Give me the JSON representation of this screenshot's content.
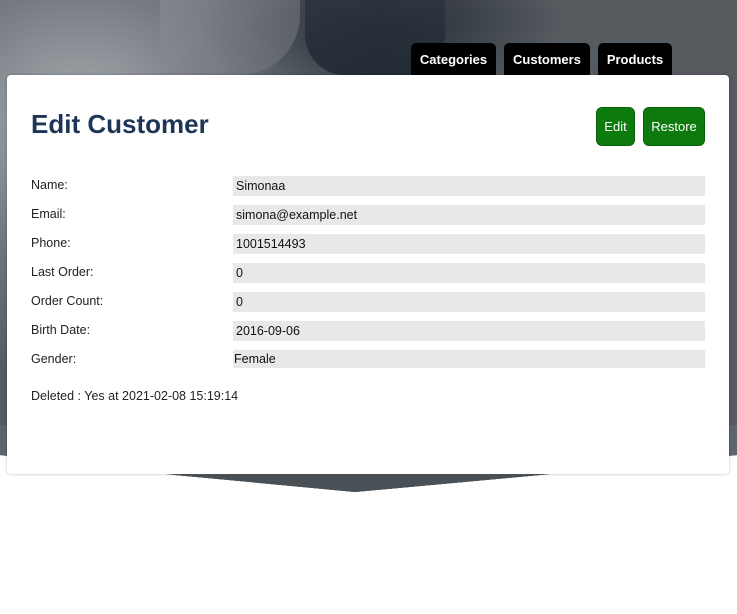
{
  "nav": {
    "tabs": [
      {
        "label": "Categories"
      },
      {
        "label": "Customers"
      },
      {
        "label": "Products"
      }
    ]
  },
  "page": {
    "title": "Edit Customer",
    "edit_label": "Edit",
    "restore_label": "Restore"
  },
  "customer": {
    "name_label": "Name:",
    "name": "Simonaa",
    "email_label": "Email:",
    "email": "simona@example.net",
    "phone_label": "Phone:",
    "phone": "1001514493",
    "last_order_label": "Last Order:",
    "last_order": "0",
    "order_count_label": "Order Count:",
    "order_count": "0",
    "birth_date_label": "Birth Date:",
    "birth_date": "2016-09-06",
    "gender_label": "Gender:",
    "gender": "Female"
  },
  "status": {
    "deleted_text": "Deleted : Yes at 2021-02-08 15:19:14"
  }
}
